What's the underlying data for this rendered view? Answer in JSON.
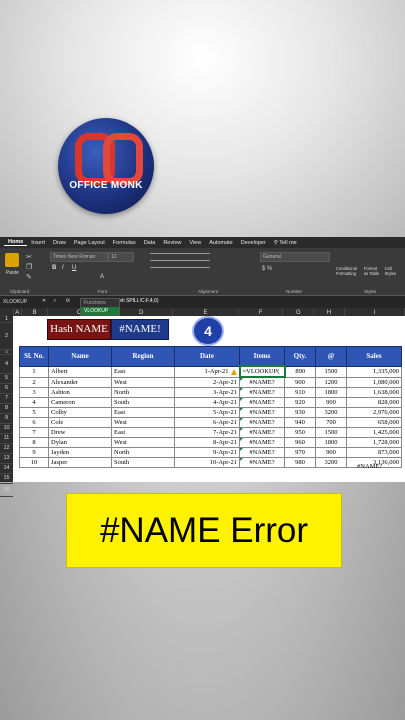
{
  "logo": {
    "line1": "OFFICE",
    "line2": "MONK"
  },
  "ribbon": {
    "tabs": [
      "Home",
      "Insert",
      "Draw",
      "Page Layout",
      "Formulas",
      "Data",
      "Review",
      "View",
      "Automate",
      "Developer",
      "Tell me"
    ],
    "paste_label": "Paste",
    "font_name": "Times New Roman",
    "font_size": "12",
    "number_format": "General",
    "groups": {
      "clipboard": "Clipboard",
      "font": "Font",
      "alignment": "Alignment",
      "number": "Number",
      "styles": "Styles"
    },
    "styles_buttons": [
      "Conditional Formatting",
      "Format as Table",
      "Cell Styles"
    ]
  },
  "formula_bar": {
    "name_box": "XLOOKUP",
    "fx": "fx",
    "formula": "=VLOOKUP( , Hash SPILL!C:F,4,0)"
  },
  "autocomplete": {
    "header": "Functions",
    "option": "VLOOKUP"
  },
  "columns": [
    "A",
    "B",
    "C",
    "D",
    "E",
    "F",
    "G",
    "H",
    "I"
  ],
  "rows": [
    "1",
    "2",
    "3",
    "4",
    "5",
    "6",
    "7",
    "8",
    "9",
    "10",
    "11",
    "12",
    "13",
    "14",
    "15",
    "16"
  ],
  "title": {
    "hash_name": "Hash NAME",
    "name_error": "#NAME!",
    "step": "4"
  },
  "table": {
    "headers": [
      "Sl. No.",
      "Name",
      "Region",
      "Date",
      "Items",
      "Qty.",
      "@",
      "Sales"
    ],
    "rows": [
      [
        "1",
        "Albert",
        "East",
        "1-Apr-21",
        "=VLOOKUP(",
        "890",
        "1500",
        "1,335,000"
      ],
      [
        "2",
        "Alexander",
        "West",
        "2-Apr-21",
        "#NAME?",
        "900",
        "1200",
        "1,080,000"
      ],
      [
        "3",
        "Ashton",
        "North",
        "3-Apr-21",
        "#NAME?",
        "910",
        "1800",
        "1,638,000"
      ],
      [
        "4",
        "Cameron",
        "South",
        "4-Apr-21",
        "#NAME?",
        "920",
        "900",
        "828,000"
      ],
      [
        "5",
        "Colby",
        "East",
        "5-Apr-21",
        "#NAME?",
        "930",
        "3200",
        "2,976,000"
      ],
      [
        "6",
        "Cole",
        "West",
        "6-Apr-21",
        "#NAME?",
        "940",
        "700",
        "658,000"
      ],
      [
        "7",
        "Drew",
        "East",
        "7-Apr-21",
        "#NAME?",
        "950",
        "1500",
        "1,425,000"
      ],
      [
        "8",
        "Dylan",
        "West",
        "8-Apr-21",
        "#NAME?",
        "960",
        "1800",
        "1,728,000"
      ],
      [
        "9",
        "Jayden",
        "North",
        "9-Apr-21",
        "#NAME?",
        "970",
        "900",
        "873,000"
      ],
      [
        "10",
        "Jasper",
        "South",
        "10-Apr-21",
        "#NAME?",
        "980",
        "3200",
        "3,136,000"
      ]
    ],
    "total_error": "#NAME?"
  },
  "banner": "#NAME Error"
}
